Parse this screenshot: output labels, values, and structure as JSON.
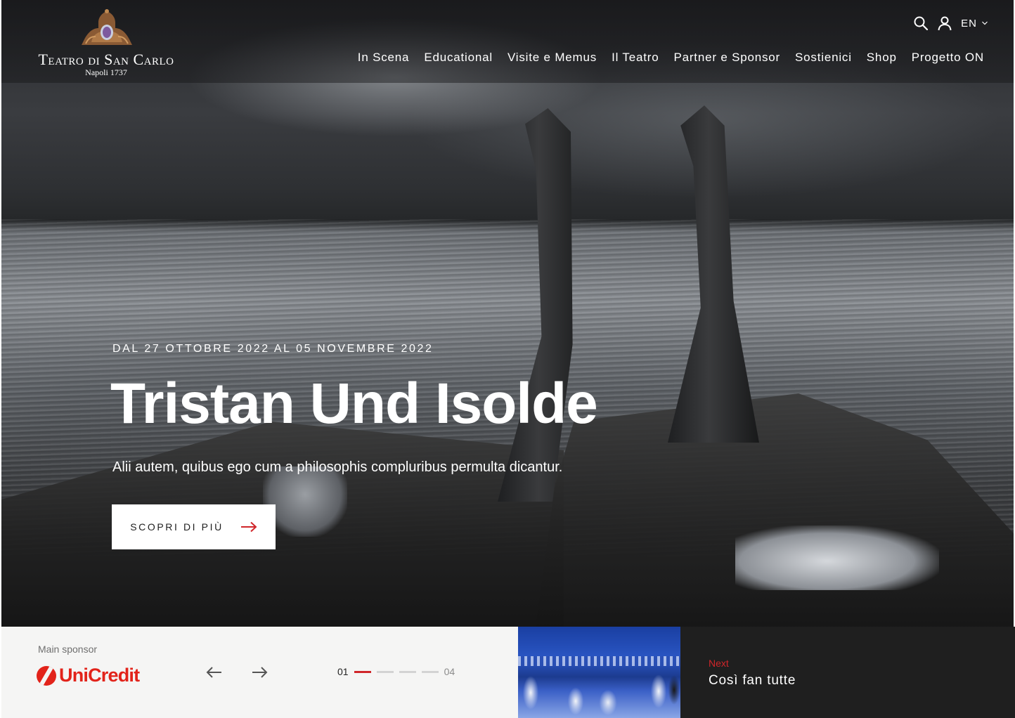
{
  "brand": {
    "name": "Teatro di San Carlo",
    "subtitle": "Napoli 1737"
  },
  "header": {
    "language": "EN",
    "nav": [
      {
        "label": "In Scena"
      },
      {
        "label": "Educational"
      },
      {
        "label": "Visite e Memus"
      },
      {
        "label": "Il Teatro"
      },
      {
        "label": "Partner e Sponsor"
      },
      {
        "label": "Sostienici"
      },
      {
        "label": "Shop"
      },
      {
        "label": "Progetto ON"
      }
    ],
    "icons": [
      "search-icon",
      "user-icon",
      "chevron-down-icon"
    ]
  },
  "hero": {
    "dates": "DAL 27 OTTOBRE 2022 AL 05 NOVEMBRE 2022",
    "title": "Tristan Und Isolde",
    "description": "Alii autem, quibus ego cum a philosophis compluribus permulta dicantur.",
    "cta_label": "SCOPRI DI PIÙ"
  },
  "sponsor": {
    "label": "Main sponsor",
    "name": "UniCredit"
  },
  "slider": {
    "current": "01",
    "total": "04",
    "active_index": 1,
    "count": 4
  },
  "next": {
    "label": "Next",
    "title": "Così fan tutte"
  },
  "colors": {
    "accent": "#d0262a",
    "sponsor_red": "#e2231a",
    "panel_dark": "#1f1f1f",
    "panel_light": "#f5f5f4"
  }
}
